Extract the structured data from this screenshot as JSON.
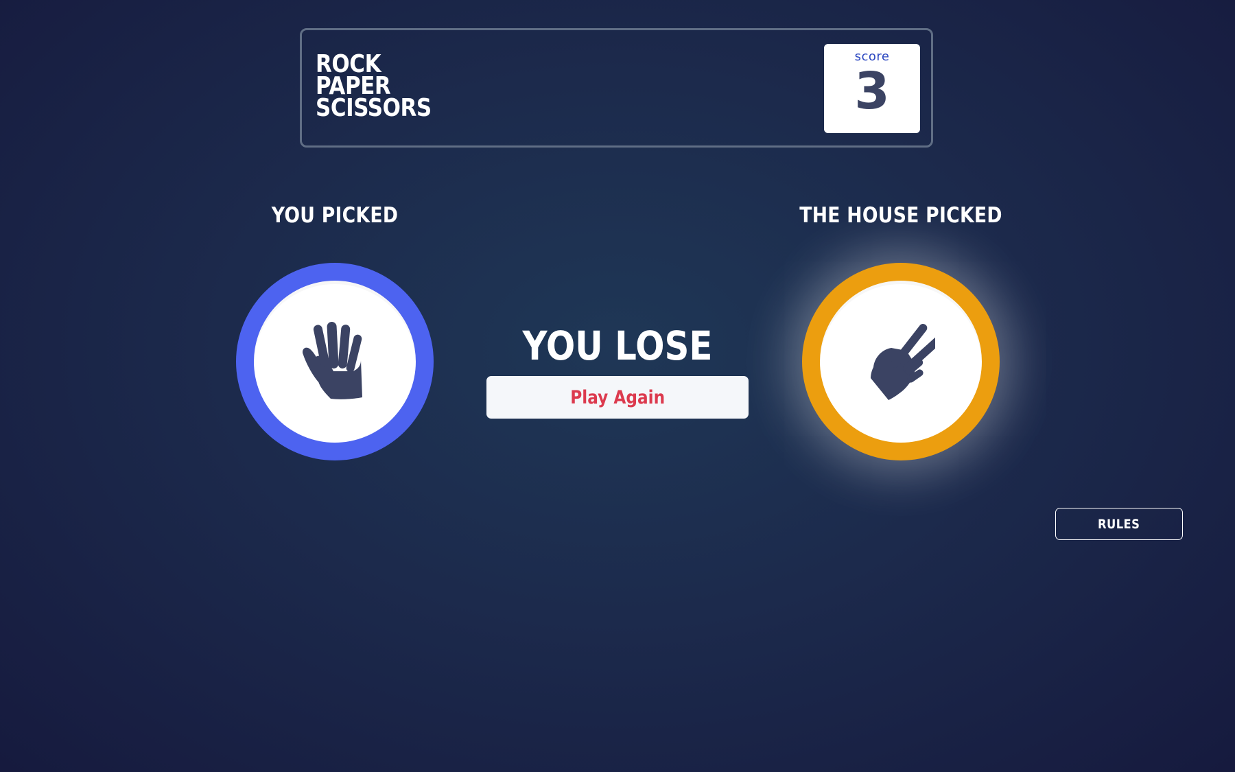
{
  "header": {
    "title_lines": [
      "ROCK",
      "PAPER",
      "SCISSORS"
    ],
    "score_label": "score",
    "score_value": "3"
  },
  "game": {
    "user_label": "YOU PICKED",
    "house_label": "THE HOUSE PICKED",
    "user_pick": "paper",
    "house_pick": "scissors",
    "result_text": "YOU LOSE",
    "play_again_label": "Play Again"
  },
  "footer": {
    "rules_label": "RULES"
  },
  "colors": {
    "paper_ring": "#4d63f0",
    "scissors_ring": "#ec9e0f",
    "icon": "#3b4363",
    "play_again_text": "#dc3a4e",
    "score_label": "#2a46c0"
  },
  "icons": {
    "user_pick_icon": "paper-hand-icon",
    "house_pick_icon": "scissors-hand-icon"
  }
}
